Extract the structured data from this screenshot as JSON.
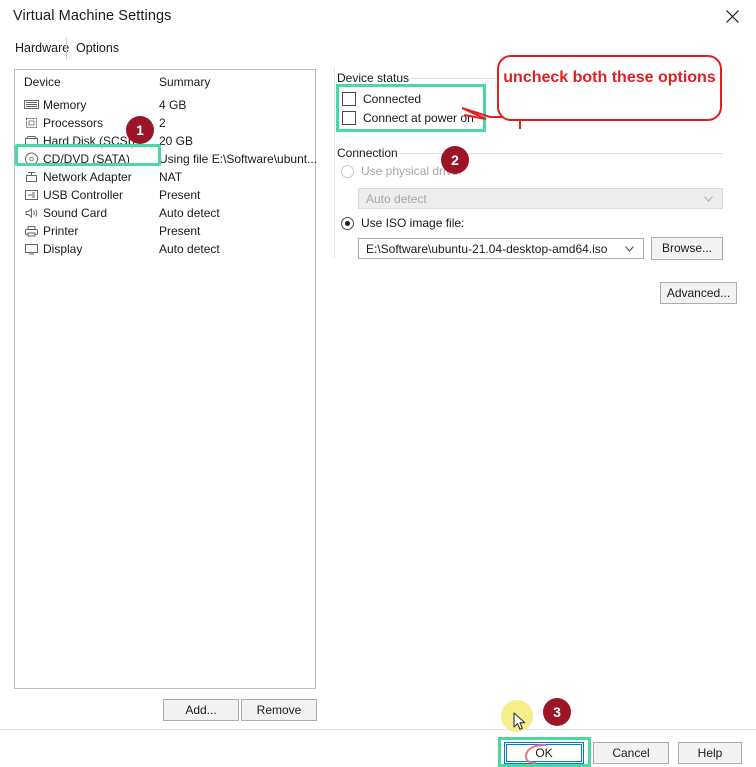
{
  "window": {
    "title": "Virtual Machine Settings",
    "close_icon": "close-icon"
  },
  "tabs": [
    {
      "label": "Hardware",
      "active": true
    },
    {
      "label": "Options",
      "active": false
    }
  ],
  "device_panel": {
    "columns": {
      "device": "Device",
      "summary": "Summary"
    },
    "rows": [
      {
        "icon": "memory-icon",
        "label": "Memory",
        "summary": "4 GB"
      },
      {
        "icon": "processor-icon",
        "label": "Processors",
        "summary": "2"
      },
      {
        "icon": "hard-disk-icon",
        "label": "Hard Disk (SCSI)",
        "summary": "20 GB"
      },
      {
        "icon": "cd-dvd-icon",
        "label": "CD/DVD (SATA)",
        "summary": "Using file E:\\Software\\ubunt..."
      },
      {
        "icon": "network-adapter-icon",
        "label": "Network Adapter",
        "summary": "NAT"
      },
      {
        "icon": "usb-controller-icon",
        "label": "USB Controller",
        "summary": "Present"
      },
      {
        "icon": "sound-card-icon",
        "label": "Sound Card",
        "summary": "Auto detect"
      },
      {
        "icon": "printer-icon",
        "label": "Printer",
        "summary": "Present"
      },
      {
        "icon": "display-icon",
        "label": "Display",
        "summary": "Auto detect"
      }
    ],
    "selected_index": 3,
    "add_label": "Add...",
    "remove_label": "Remove"
  },
  "device_status": {
    "group_label": "Device status",
    "connected": {
      "label": "Connected",
      "checked": false
    },
    "connect_at_power_on": {
      "label": "Connect at power on",
      "checked": false
    }
  },
  "connection": {
    "group_label": "Connection",
    "use_physical_drive": {
      "label": "Use physical drive:",
      "selected": false,
      "disabled": true,
      "value": "Auto detect"
    },
    "use_iso_image": {
      "label": "Use ISO image file:",
      "selected": true,
      "value": "E:\\Software\\ubuntu-21.04-desktop-amd64.iso"
    },
    "browse_label": "Browse...",
    "advanced_label": "Advanced..."
  },
  "dialog_buttons": {
    "ok": "OK",
    "cancel": "Cancel",
    "help": "Help"
  },
  "annotations": {
    "callout_text": "uncheck both these options",
    "badges": [
      "1",
      "2",
      "3"
    ],
    "highlight_color": "#4ad9a0",
    "callout_color": "#e02020",
    "badge_color": "#9b1526",
    "cursor_glow_color": "#f5ee8a"
  }
}
